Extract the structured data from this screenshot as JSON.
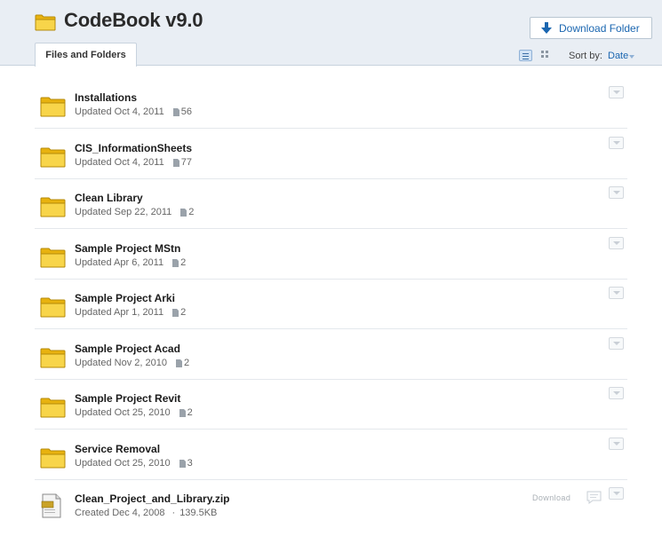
{
  "header": {
    "title": "CodeBook v9.0",
    "download_button": "Download Folder",
    "tab": "Files and Folders",
    "sort_label": "Sort by:",
    "sort_value": "Date"
  },
  "items": [
    {
      "name": "Installations",
      "meta": "Updated Oct 4, 2011",
      "count": "56"
    },
    {
      "name": "CIS_InformationSheets",
      "meta": "Updated Oct 4, 2011",
      "count": "77"
    },
    {
      "name": "Clean Library",
      "meta": "Updated Sep 22, 2011",
      "count": "2"
    },
    {
      "name": "Sample Project MStn",
      "meta": "Updated Apr 6, 2011",
      "count": "2"
    },
    {
      "name": "Sample Project Arki",
      "meta": "Updated Apr 1, 2011",
      "count": "2"
    },
    {
      "name": "Sample Project Acad",
      "meta": "Updated Nov 2, 2010",
      "count": "2"
    },
    {
      "name": "Sample Project Revit",
      "meta": "Updated Oct 25, 2010",
      "count": "2"
    },
    {
      "name": "Service Removal",
      "meta": "Updated Oct 25, 2010",
      "count": "3"
    }
  ],
  "file": {
    "name": "Clean_Project_and_Library.zip",
    "meta": "Created Dec 4, 2008",
    "separator": "·",
    "size": "139.5KB",
    "download": "Download"
  },
  "colors": {
    "header_bg": "#e9eef4",
    "link_blue": "#1a66b0",
    "folder_yellow": "#f5c518"
  },
  "icons": [
    "folder-icon",
    "download-arrow-icon",
    "list-view-icon",
    "grid-view-icon",
    "file-count-icon",
    "menu-caret-icon",
    "zip-file-icon",
    "comment-icon"
  ]
}
